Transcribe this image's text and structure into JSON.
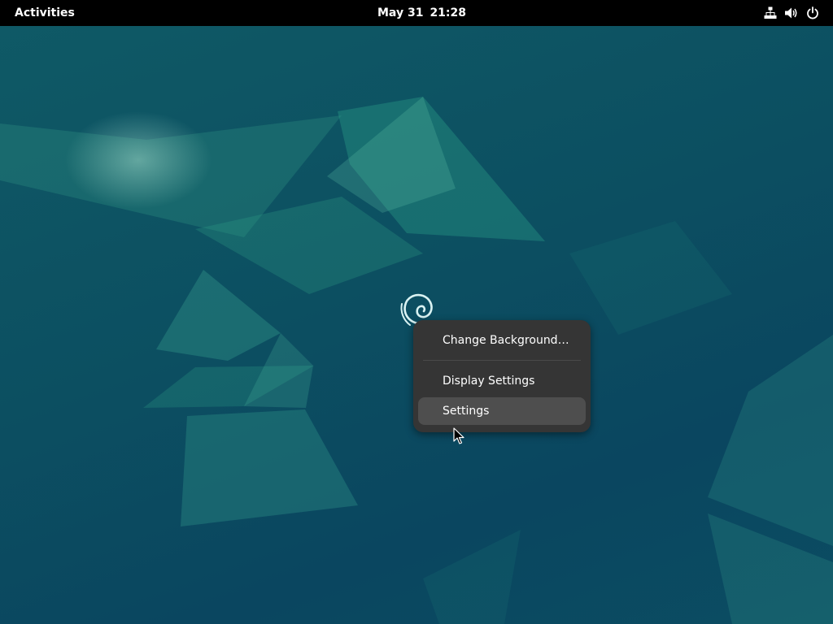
{
  "top_bar": {
    "activities_label": "Activities",
    "date": "May 31",
    "time": "21:28",
    "status_icons": [
      "network-wired-icon",
      "volume-icon",
      "power-icon"
    ]
  },
  "desktop": {
    "logo_icon": "debian-swirl-icon"
  },
  "context_menu": {
    "items": [
      {
        "label": "Change Background…"
      },
      {
        "label": "Display Settings"
      },
      {
        "label": "Settings",
        "highlighted": true
      }
    ]
  },
  "colors": {
    "top_bar_bg": "#000000",
    "menu_bg": "#353535",
    "menu_highlight": "#4e4e4e",
    "wallpaper_base": "#0c4f61"
  }
}
